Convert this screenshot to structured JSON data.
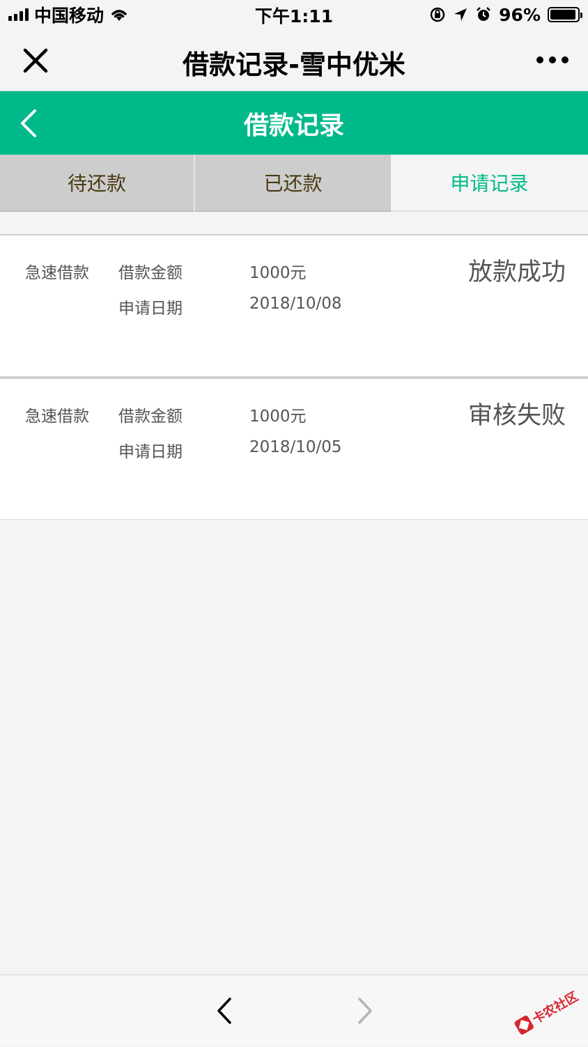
{
  "status_bar": {
    "carrier": "中国移动",
    "time": "下午1:11",
    "battery_percent": "96%",
    "battery_level": 0.96
  },
  "wechat_bar": {
    "title": "借款记录-雪中优米"
  },
  "header": {
    "title": "借款记录"
  },
  "tabs": [
    {
      "label": "待还款",
      "active": false
    },
    {
      "label": "已还款",
      "active": false
    },
    {
      "label": "申请记录",
      "active": true
    }
  ],
  "records": [
    {
      "type": "急速借款",
      "amount_label": "借款金额",
      "amount": "1000元",
      "date_label": "申请日期",
      "date": "2018/10/08",
      "status": "放款成功"
    },
    {
      "type": "急速借款",
      "amount_label": "借款金额",
      "amount": "1000元",
      "date_label": "申请日期",
      "date": "2018/10/05",
      "status": "审核失败"
    }
  ],
  "watermark": {
    "text": "卡农社区"
  },
  "colors": {
    "brand_green": "#00b98b",
    "text_gray": "#555555",
    "tab_inactive_bg": "#cdcdcd"
  }
}
